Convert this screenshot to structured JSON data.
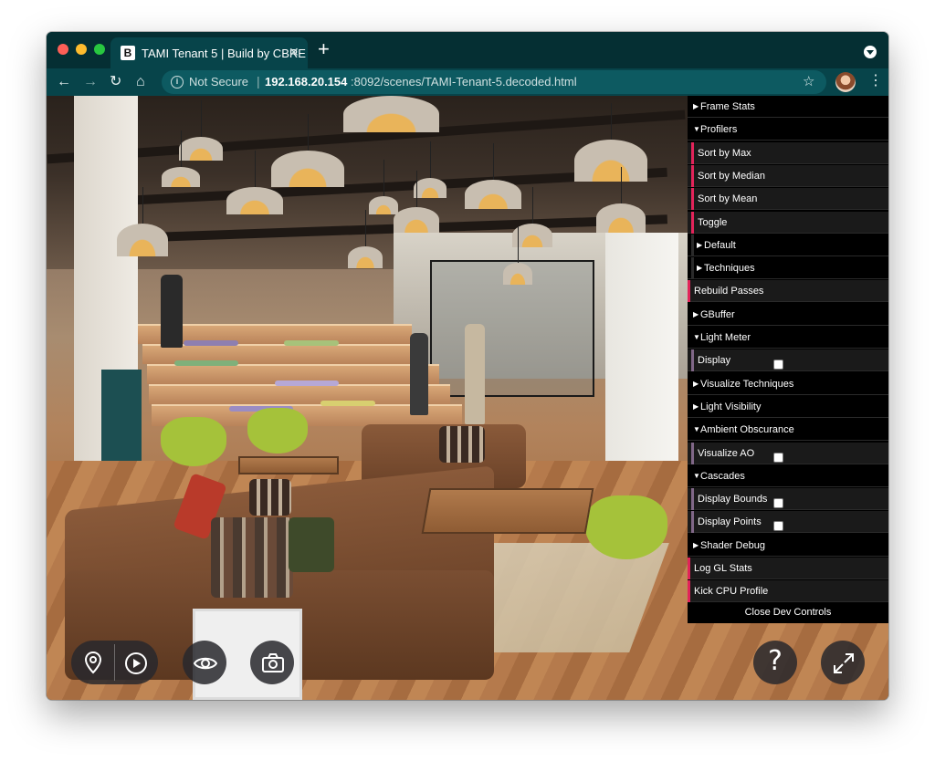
{
  "browser": {
    "tab": {
      "favicon": "B",
      "title": "TAMI Tenant 5 | Build by CBRE",
      "close": "✕"
    },
    "new_tab": "+",
    "address": {
      "security": "Not Secure",
      "separator": "|",
      "host": "192.168.20.154",
      "path": ":8092/scenes/TAMI-Tenant-5.decoded.html"
    },
    "nav": {
      "back": "←",
      "forward": "→",
      "reload": "↻",
      "home": "⌂",
      "star": "☆",
      "menu": "⋮"
    }
  },
  "dev_controls": {
    "items": [
      {
        "label": "Frame Stats",
        "kind": "folder",
        "state": "closed"
      },
      {
        "label": "Profilers",
        "kind": "folder",
        "state": "open"
      },
      {
        "label": "Sort by Max",
        "kind": "button",
        "bar": "#e2245a"
      },
      {
        "label": "Sort by Median",
        "kind": "button",
        "bar": "#e2245a"
      },
      {
        "label": "Sort by Mean",
        "kind": "button",
        "bar": "#e2245a"
      },
      {
        "label": "Toggle",
        "kind": "button",
        "bar": "#e2245a"
      },
      {
        "label": "Default",
        "kind": "folder",
        "state": "closed"
      },
      {
        "label": "Techniques",
        "kind": "folder",
        "state": "closed"
      },
      {
        "label": "Rebuild Passes",
        "kind": "button",
        "bar": "#e2245a"
      },
      {
        "label": "GBuffer",
        "kind": "folder",
        "state": "closed"
      },
      {
        "label": "Light Meter",
        "kind": "folder",
        "state": "open"
      },
      {
        "label": "Display",
        "kind": "checkbox",
        "bar": "#806787"
      },
      {
        "label": "Visualize Techniques",
        "kind": "folder",
        "state": "closed"
      },
      {
        "label": "Light Visibility",
        "kind": "folder",
        "state": "closed"
      },
      {
        "label": "Ambient Obscurance",
        "kind": "folder",
        "state": "open"
      },
      {
        "label": "Visualize AO",
        "kind": "checkbox",
        "bar": "#806787"
      },
      {
        "label": "Cascades",
        "kind": "folder",
        "state": "open"
      },
      {
        "label": "Display Bounds",
        "kind": "checkbox",
        "bar": "#806787"
      },
      {
        "label": "Display Points",
        "kind": "checkbox",
        "bar": "#806787"
      },
      {
        "label": "Shader Debug",
        "kind": "folder",
        "state": "closed"
      },
      {
        "label": "Log GL Stats",
        "kind": "button",
        "bar": "#e2245a"
      },
      {
        "label": "Kick CPU Profile",
        "kind": "button",
        "bar": "#e2245a"
      }
    ],
    "close_label": "Close Dev Controls"
  },
  "controls": {
    "location": "location-pin-icon",
    "play": "play-icon",
    "view": "eye-icon",
    "camera": "camera-icon",
    "help": "?",
    "fullscreen": "expand-icon"
  }
}
